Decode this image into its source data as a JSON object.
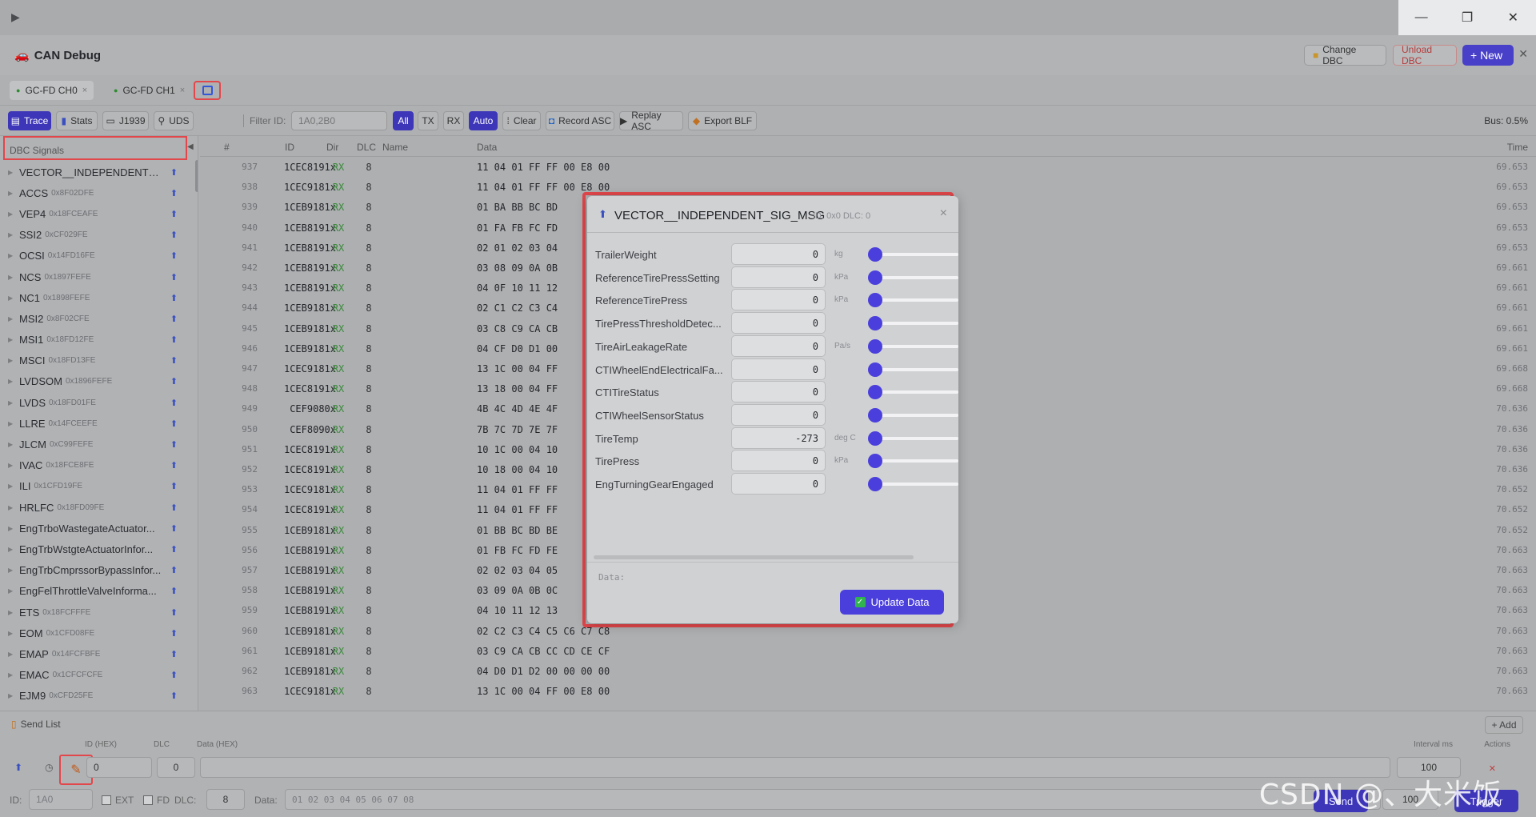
{
  "window": {
    "minimize": "—",
    "maximize": "❐",
    "close": "✕"
  },
  "app": {
    "title": "CAN Debug",
    "change_dbc": "Change DBC",
    "unload_dbc": "Unload DBC",
    "new": "+ New"
  },
  "channels": [
    {
      "label": "GC-FD CH0",
      "close": "×"
    },
    {
      "label": "GC-FD CH1",
      "close": "×"
    }
  ],
  "toolbar": {
    "trace": "Trace",
    "stats": "Stats",
    "j1939": "J1939",
    "uds": "UDS",
    "filter_label": "Filter ID:",
    "filter_placeholder": "1A0,2B0",
    "all": "All",
    "tx": "TX",
    "rx": "RX",
    "auto": "Auto",
    "clear": "Clear",
    "record": "Record ASC",
    "replay": "Replay ASC",
    "export": "Export BLF",
    "bus": "Bus: 0.5%"
  },
  "sidebar": {
    "header": "DBC Signals",
    "items": [
      {
        "name": "VECTOR__INDEPENDENT_SI...",
        "id": ""
      },
      {
        "name": "ACCS",
        "id": "0x8F02DFE"
      },
      {
        "name": "VEP4",
        "id": "0x18FCEAFE"
      },
      {
        "name": "SSI2",
        "id": "0xCF029FE"
      },
      {
        "name": "OCSI",
        "id": "0x14FD16FE"
      },
      {
        "name": "NCS",
        "id": "0x1897FEFE"
      },
      {
        "name": "NC1",
        "id": "0x1898FEFE"
      },
      {
        "name": "MSI2",
        "id": "0x8F02CFE"
      },
      {
        "name": "MSI1",
        "id": "0x18FD12FE"
      },
      {
        "name": "MSCI",
        "id": "0x18FD13FE"
      },
      {
        "name": "LVDSOM",
        "id": "0x1896FEFE"
      },
      {
        "name": "LVDS",
        "id": "0x18FD01FE"
      },
      {
        "name": "LLRE",
        "id": "0x14FCEEFE"
      },
      {
        "name": "JLCM",
        "id": "0xC99FEFE"
      },
      {
        "name": "IVAC",
        "id": "0x18FCE8FE"
      },
      {
        "name": "ILI",
        "id": "0x1CFD19FE"
      },
      {
        "name": "HRLFC",
        "id": "0x18FD09FE"
      },
      {
        "name": "EngTrboWastegateActuator...",
        "id": ""
      },
      {
        "name": "EngTrbWstgteActuatorInfor...",
        "id": ""
      },
      {
        "name": "EngTrbCmprssorBypassInfor...",
        "id": ""
      },
      {
        "name": "EngFelThrottleValveInforma...",
        "id": ""
      },
      {
        "name": "ETS",
        "id": "0x18FCFFFE"
      },
      {
        "name": "EOM",
        "id": "0x1CFD08FE"
      },
      {
        "name": "EMAP",
        "id": "0x14FCFBFE"
      },
      {
        "name": "EMAC",
        "id": "0x1CFCFCFE"
      },
      {
        "name": "EJM9",
        "id": "0xCFD25FE"
      },
      {
        "name": "EJM8",
        "id": "0xCFD27FE"
      }
    ]
  },
  "trace": {
    "headers": {
      "no": "#",
      "id": "ID",
      "dir": "Dir",
      "dlc": "DLC",
      "name": "Name",
      "data": "Data",
      "time": "Time"
    },
    "rows": [
      {
        "no": "937",
        "id": "1CEC8191x",
        "dir": "RX",
        "dlc": "8",
        "data": "11 04 01 FF FF 00 E8 00",
        "time": "69.653"
      },
      {
        "no": "938",
        "id": "1CEC9181x",
        "dir": "RX",
        "dlc": "8",
        "data": "11 04 01 FF FF 00 E8 00",
        "time": "69.653"
      },
      {
        "no": "939",
        "id": "1CEB9181x",
        "dir": "RX",
        "dlc": "8",
        "data": "01 BA BB BC BD",
        "time": "69.653"
      },
      {
        "no": "940",
        "id": "1CEB8191x",
        "dir": "RX",
        "dlc": "8",
        "data": "01 FA FB FC FD",
        "time": "69.653"
      },
      {
        "no": "941",
        "id": "1CEB8191x",
        "dir": "RX",
        "dlc": "8",
        "data": "02 01 02 03 04",
        "time": "69.653"
      },
      {
        "no": "942",
        "id": "1CEB8191x",
        "dir": "RX",
        "dlc": "8",
        "data": "03 08 09 0A 0B",
        "time": "69.661"
      },
      {
        "no": "943",
        "id": "1CEB8191x",
        "dir": "RX",
        "dlc": "8",
        "data": "04 0F 10 11 12",
        "time": "69.661"
      },
      {
        "no": "944",
        "id": "1CEB9181x",
        "dir": "RX",
        "dlc": "8",
        "data": "02 C1 C2 C3 C4",
        "time": "69.661"
      },
      {
        "no": "945",
        "id": "1CEB9181x",
        "dir": "RX",
        "dlc": "8",
        "data": "03 C8 C9 CA CB",
        "time": "69.661"
      },
      {
        "no": "946",
        "id": "1CEB9181x",
        "dir": "RX",
        "dlc": "8",
        "data": "04 CF D0 D1 00",
        "time": "69.661"
      },
      {
        "no": "947",
        "id": "1CEC9181x",
        "dir": "RX",
        "dlc": "8",
        "data": "13 1C 00 04 FF",
        "time": "69.668"
      },
      {
        "no": "948",
        "id": "1CEC8191x",
        "dir": "RX",
        "dlc": "8",
        "data": "13 18 00 04 FF",
        "time": "69.668"
      },
      {
        "no": "949",
        "id": "CEF9080x",
        "dir": "RX",
        "dlc": "8",
        "data": "4B 4C 4D 4E 4F",
        "time": "70.636"
      },
      {
        "no": "950",
        "id": "CEF8090x",
        "dir": "RX",
        "dlc": "8",
        "data": "7B 7C 7D 7E 7F",
        "time": "70.636"
      },
      {
        "no": "951",
        "id": "1CEC8191x",
        "dir": "RX",
        "dlc": "8",
        "data": "10 1C 00 04 10",
        "time": "70.636"
      },
      {
        "no": "952",
        "id": "1CEC8191x",
        "dir": "RX",
        "dlc": "8",
        "data": "10 18 00 04 10",
        "time": "70.636"
      },
      {
        "no": "953",
        "id": "1CEC9181x",
        "dir": "RX",
        "dlc": "8",
        "data": "11 04 01 FF FF",
        "time": "70.652"
      },
      {
        "no": "954",
        "id": "1CEC8191x",
        "dir": "RX",
        "dlc": "8",
        "data": "11 04 01 FF FF",
        "time": "70.652"
      },
      {
        "no": "955",
        "id": "1CEB9181x",
        "dir": "RX",
        "dlc": "8",
        "data": "01 BB BC BD BE",
        "time": "70.652"
      },
      {
        "no": "956",
        "id": "1CEB8191x",
        "dir": "RX",
        "dlc": "8",
        "data": "01 FB FC FD FE",
        "time": "70.663"
      },
      {
        "no": "957",
        "id": "1CEB8191x",
        "dir": "RX",
        "dlc": "8",
        "data": "02 02 03 04 05",
        "time": "70.663"
      },
      {
        "no": "958",
        "id": "1CEB8191x",
        "dir": "RX",
        "dlc": "8",
        "data": "03 09 0A 0B 0C",
        "time": "70.663"
      },
      {
        "no": "959",
        "id": "1CEB8191x",
        "dir": "RX",
        "dlc": "8",
        "data": "04 10 11 12 13",
        "time": "70.663"
      },
      {
        "no": "960",
        "id": "1CEB9181x",
        "dir": "RX",
        "dlc": "8",
        "data": "02 C2 C3 C4 C5 C6 C7 C8",
        "time": "70.663"
      },
      {
        "no": "961",
        "id": "1CEB9181x",
        "dir": "RX",
        "dlc": "8",
        "data": "03 C9 CA CB CC CD CE CF",
        "time": "70.663"
      },
      {
        "no": "962",
        "id": "1CEB9181x",
        "dir": "RX",
        "dlc": "8",
        "data": "04 D0 D1 D2 00 00 00 00",
        "time": "70.663"
      },
      {
        "no": "963",
        "id": "1CEC9181x",
        "dir": "RX",
        "dlc": "8",
        "data": "13 1C 00 04 FF 00 E8 00",
        "time": "70.663"
      }
    ]
  },
  "modal": {
    "title": "VECTOR__INDEPENDENT_SIG_MSG",
    "subtitle": "ID: 0x0 DLC: 0",
    "close": "×",
    "signals": [
      {
        "name": "TrailerWeight",
        "value": "0",
        "unit": "kg"
      },
      {
        "name": "ReferenceTirePressSetting",
        "value": "0",
        "unit": "kPa"
      },
      {
        "name": "ReferenceTirePress",
        "value": "0",
        "unit": "kPa"
      },
      {
        "name": "TirePressThresholdDetec...",
        "value": "0",
        "unit": ""
      },
      {
        "name": "TireAirLeakageRate",
        "value": "0",
        "unit": "Pa/s"
      },
      {
        "name": "CTIWheelEndElectricalFa...",
        "value": "0",
        "unit": ""
      },
      {
        "name": "CTITireStatus",
        "value": "0",
        "unit": ""
      },
      {
        "name": "CTIWheelSensorStatus",
        "value": "0",
        "unit": ""
      },
      {
        "name": "TireTemp",
        "value": "-273",
        "unit": "deg C"
      },
      {
        "name": "TirePress",
        "value": "0",
        "unit": "kPa"
      },
      {
        "name": "EngTurningGearEngaged",
        "value": "0",
        "unit": ""
      }
    ],
    "data_label": "Data:",
    "update": "Update Data"
  },
  "sendlist": {
    "title": "Send List",
    "add": "+ Add",
    "col_id": "ID (HEX)",
    "col_dlc": "DLC",
    "col_data": "Data (HEX)",
    "col_interval": "Interval ms",
    "col_actions": "Actions",
    "row": {
      "id": "0",
      "dlc": "0",
      "interval": "100",
      "remove": "✕"
    },
    "quick": {
      "id_label": "ID:",
      "id_value": "1A0",
      "ext": "EXT",
      "fd": "FD",
      "dlc_label": "DLC:",
      "dlc_value": "8",
      "data_label": "Data:",
      "data_value": "01 02 03 04 05 06 07 08",
      "interval": "100",
      "send": "Send",
      "trigger": "Trigger"
    }
  },
  "watermark": "CSDN @、大米饭"
}
